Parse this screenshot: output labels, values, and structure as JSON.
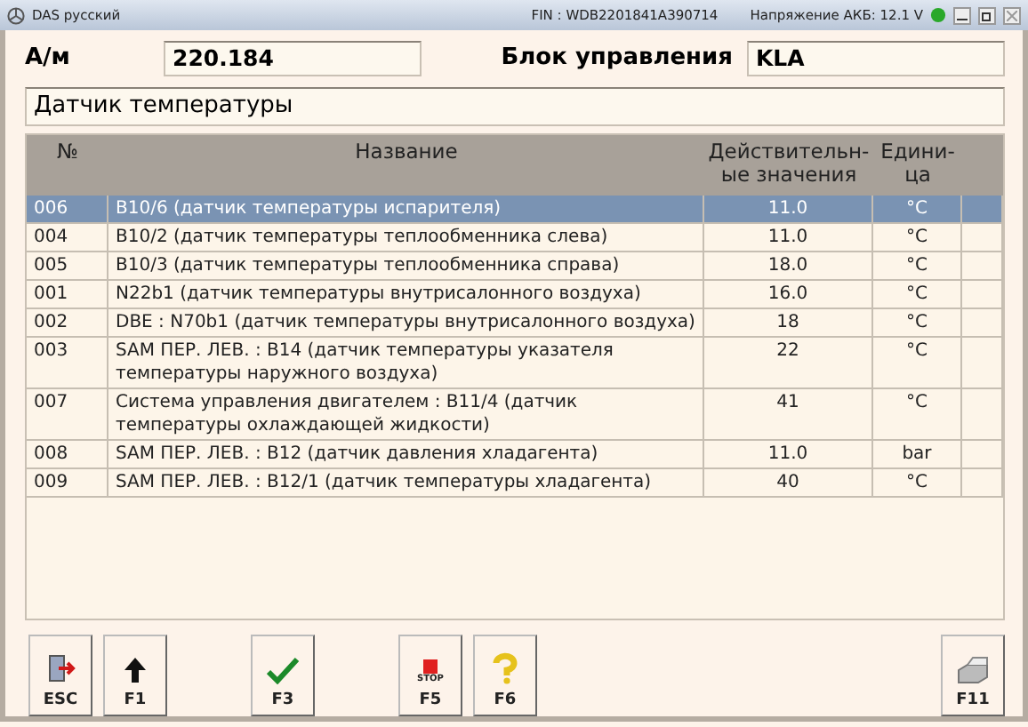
{
  "window": {
    "title": "DAS русский",
    "fin": "FIN : WDB2201841A390714",
    "battery": "Напряжение АКБ: 12.1 V"
  },
  "model_label": "А/м",
  "model_value": "220.184",
  "unit_label": "Блок управления",
  "unit_value": "KLA",
  "section_title": "Датчик температуры",
  "table": {
    "columns": [
      "№",
      "Название",
      "Действительн-ые значения",
      "Едини-ца"
    ],
    "rows": [
      {
        "no": "006",
        "name": "B10/6 (датчик температуры испарителя)",
        "value": "11.0",
        "unit": "°C",
        "selected": true
      },
      {
        "no": "004",
        "name": "B10/2 (датчик температуры теплообменника слева)",
        "value": "11.0",
        "unit": "°C",
        "selected": false
      },
      {
        "no": "005",
        "name": "B10/3 (датчик температуры теплообменника справа)",
        "value": "18.0",
        "unit": "°C",
        "selected": false
      },
      {
        "no": "001",
        "name": "N22b1 (датчик температуры внутрисалонного воздуха)",
        "value": "16.0",
        "unit": "°C",
        "selected": false
      },
      {
        "no": "002",
        "name": "DBE : N70b1 (датчик температуры внутрисалонного воздуха)",
        "value": "18",
        "unit": "°C",
        "selected": false
      },
      {
        "no": "003",
        "name": "SAM ПЕР. ЛЕВ. : B14 (датчик температуры указателя температуры наружного воздуха)",
        "value": "22",
        "unit": "°C",
        "selected": false
      },
      {
        "no": "007",
        "name": "Система управления двигателем : B11/4 (датчик температуры охлаждающей жидкости)",
        "value": "41",
        "unit": "°C",
        "selected": false
      },
      {
        "no": "008",
        "name": "SAM ПЕР. ЛЕВ. : B12 (датчик давления хладагента)",
        "value": "11.0",
        "unit": "bar",
        "selected": false
      },
      {
        "no": "009",
        "name": "SAM ПЕР. ЛЕВ. : B12/1 (датчик температуры хладагента)",
        "value": "40",
        "unit": "°C",
        "selected": false
      }
    ]
  },
  "buttons": [
    {
      "kind": "exit",
      "label": "ESC"
    },
    {
      "kind": "up",
      "label": "F1"
    },
    {
      "kind": "gap"
    },
    {
      "kind": "check",
      "label": "F3"
    },
    {
      "kind": "gap"
    },
    {
      "kind": "stop",
      "label": "F5",
      "icon_text": "STOP"
    },
    {
      "kind": "help",
      "label": "F6"
    },
    {
      "kind": "spacer"
    },
    {
      "kind": "print",
      "label": "F11"
    }
  ]
}
